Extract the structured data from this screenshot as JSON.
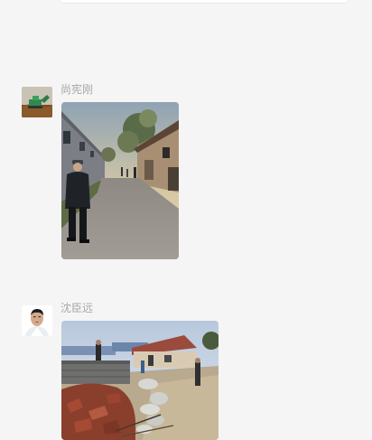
{
  "messages": [
    {
      "sender": "尚宪刚",
      "avatar_icon": "excavator-avatar-icon",
      "content_type": "photo",
      "photo_subject": "alley-with-man-photo"
    },
    {
      "sender": "沈臣远",
      "avatar_icon": "portrait-avatar-icon",
      "content_type": "photo",
      "photo_subject": "construction-site-photo"
    }
  ],
  "colors": {
    "background": "#f5f5f5",
    "sender_name": "#a8a8a8"
  }
}
